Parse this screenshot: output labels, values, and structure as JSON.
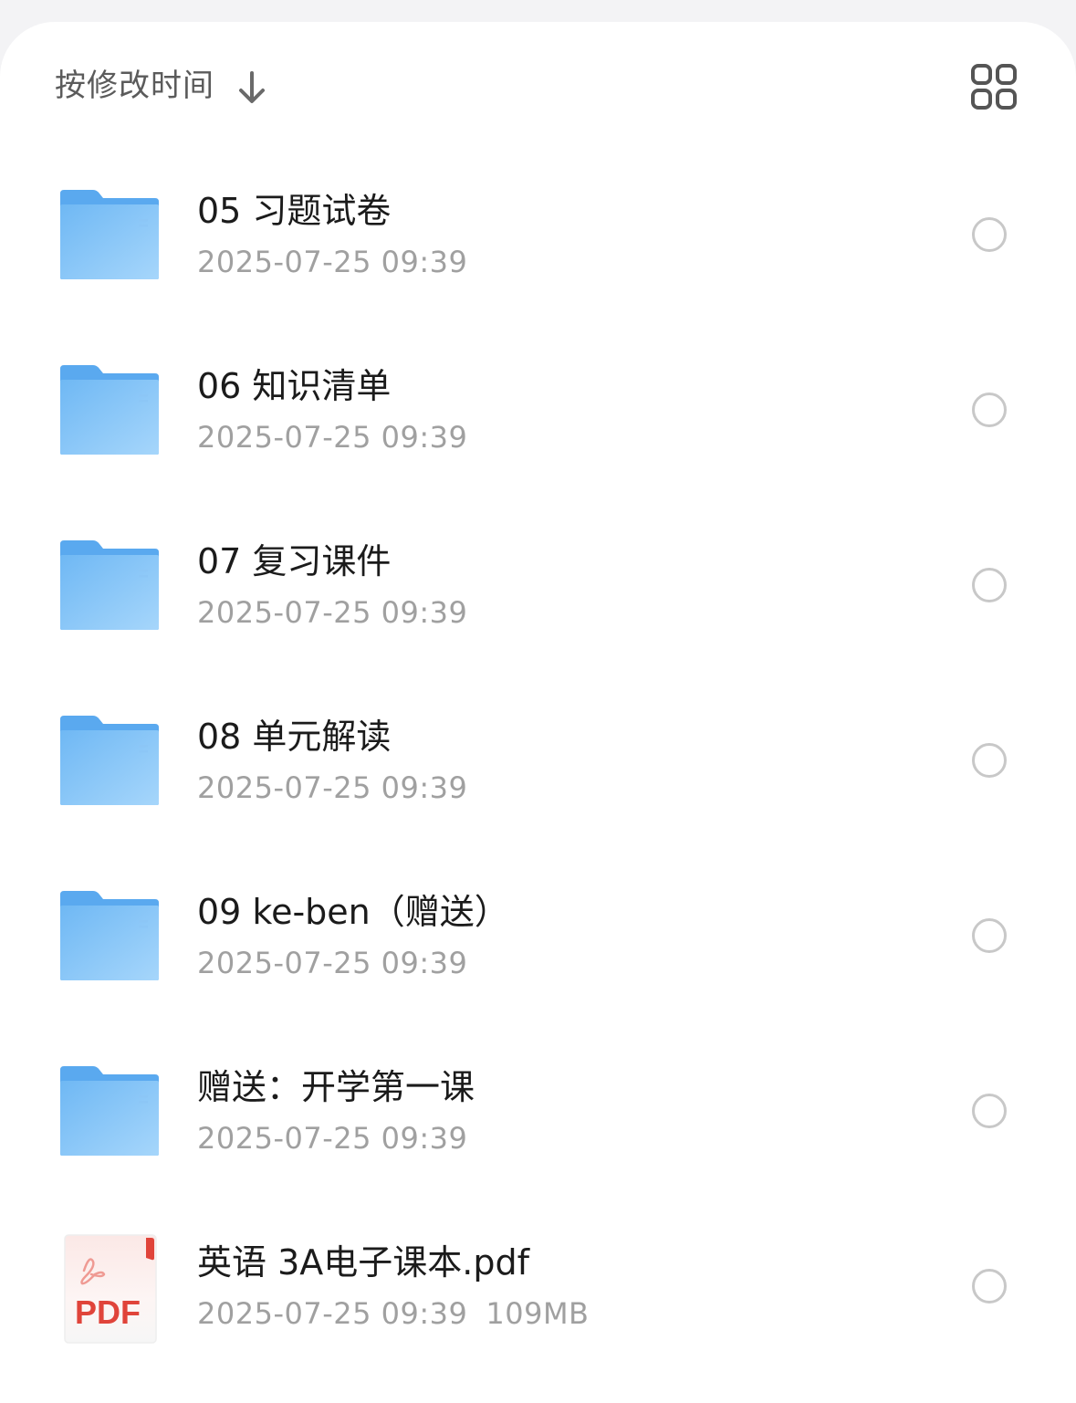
{
  "toolbar": {
    "sort_label": "按修改时间",
    "sort_icon": "arrow-down-icon",
    "view_toggle_icon": "grid-view-icon"
  },
  "colors": {
    "folder": "#7ec3f7",
    "folder_tab": "#5aa9ef",
    "pdf_red": "#e0443a",
    "radio_border": "#c8c8c8",
    "meta_text": "#a0a0a0"
  },
  "files": [
    {
      "type": "folder",
      "name": "05 习题试卷",
      "modified": "2025-07-25 09:39",
      "size": ""
    },
    {
      "type": "folder",
      "name": "06 知识清单",
      "modified": "2025-07-25 09:39",
      "size": ""
    },
    {
      "type": "folder",
      "name": "07 复习课件",
      "modified": "2025-07-25 09:39",
      "size": ""
    },
    {
      "type": "folder",
      "name": "08 单元解读",
      "modified": "2025-07-25 09:39",
      "size": ""
    },
    {
      "type": "folder",
      "name": "09 ke-ben（赠送）",
      "modified": "2025-07-25 09:39",
      "size": ""
    },
    {
      "type": "folder",
      "name": "赠送：开学第一课",
      "modified": "2025-07-25 09:39",
      "size": ""
    },
    {
      "type": "pdf",
      "name": "英语 3A电子课本.pdf",
      "modified": "2025-07-25 09:39",
      "size": "109MB",
      "badge": "PDF"
    }
  ]
}
